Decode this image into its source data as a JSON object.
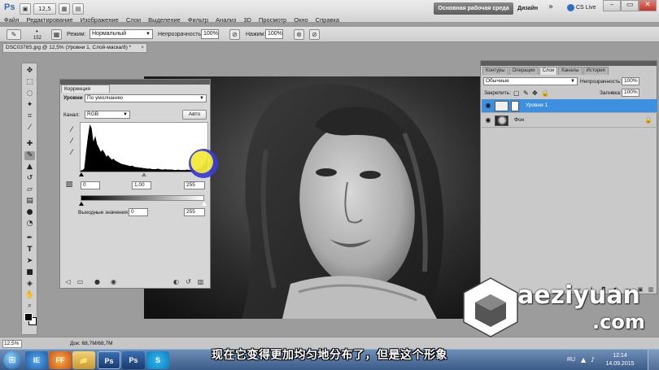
{
  "app": {
    "logo": "Ps",
    "top_buttons": [
      "▣",
      "12,5",
      "▦",
      "▤"
    ],
    "workspace_button": "Основная рабочая среда",
    "design_button": "Дизайн",
    "more_glyph": "»",
    "cslive": "CS Live",
    "window_controls": [
      "–",
      "▭",
      "✕"
    ]
  },
  "menu": [
    "Файл",
    "Редактирование",
    "Изображение",
    "Слои",
    "Выделение",
    "Фильтр",
    "Анализ",
    "3D",
    "Просмотр",
    "Окно",
    "Справка"
  ],
  "options_bar": {
    "brush_size": "152",
    "mode_label": "Режим:",
    "mode_value": "Нормальный",
    "opacity_label": "Непрозрачность:",
    "opacity_value": "100%",
    "pressure_label": "Нажим:",
    "pressure_value": "100%"
  },
  "document_tab": {
    "title": "DSC0378S.jpg @ 12,5% (Уровни 1, Слой-маска/8) *",
    "close": "×"
  },
  "adjustments": {
    "panel_tab": "Коррекция",
    "levels_label": "Уровни",
    "preset_value": "По умолчанию",
    "channel_label": "Канал:",
    "channel_value": "RGB",
    "auto_button": "Авто",
    "input_black": "0",
    "input_gamma": "1,00",
    "input_white": "255",
    "output_label": "Выходные значения:",
    "output_black": "0",
    "output_white": "255",
    "histogram": [
      2,
      3,
      6,
      40,
      70,
      95,
      88,
      60,
      72,
      55,
      48,
      40,
      44,
      38,
      30,
      33,
      28,
      24,
      26,
      22,
      20,
      18,
      16,
      15,
      14,
      13,
      12,
      11,
      12,
      10,
      9,
      9,
      8,
      8,
      7,
      7,
      6,
      6,
      6,
      5,
      5,
      5,
      6,
      5,
      4,
      4,
      5,
      4,
      4,
      4,
      4,
      3,
      3,
      4,
      3,
      3,
      3,
      3,
      4,
      3,
      3,
      3,
      4,
      5,
      6,
      8,
      10,
      14,
      20,
      30
    ]
  },
  "layers": {
    "tabs": [
      "Контуры",
      "Операции",
      "Слои",
      "Каналы",
      "История"
    ],
    "active_tab": "Слои",
    "blend_mode": "Обычные",
    "opacity_label": "Непрозрачность:",
    "opacity_value": "100%",
    "lock_label": "Закрепить:",
    "fill_label": "Заливка:",
    "fill_value": "100%",
    "items": [
      {
        "name": "Уровни 1",
        "selected": true
      },
      {
        "name": "Фон",
        "selected": false
      }
    ]
  },
  "status": {
    "zoom": "12,5%",
    "doc_size": "Док: 68,7M/68,7M"
  },
  "taskbar": {
    "apps": [
      "IE",
      "FF",
      "📁",
      "Ps",
      "Ps",
      "S"
    ],
    "lang": "RU",
    "time": "12:14",
    "date": "14.09.2015"
  },
  "subtitle": "现在它变得更加均匀地分布了，但是这个形象",
  "watermark": {
    "main": "aeziyuan",
    "sub": ".com"
  },
  "colors": {
    "selected_layer": "#3d8fe0",
    "workspace_button": "#6e6e6e",
    "highlight_yellow": "#f2ea3a",
    "highlight_blue": "#3b3bd6"
  }
}
